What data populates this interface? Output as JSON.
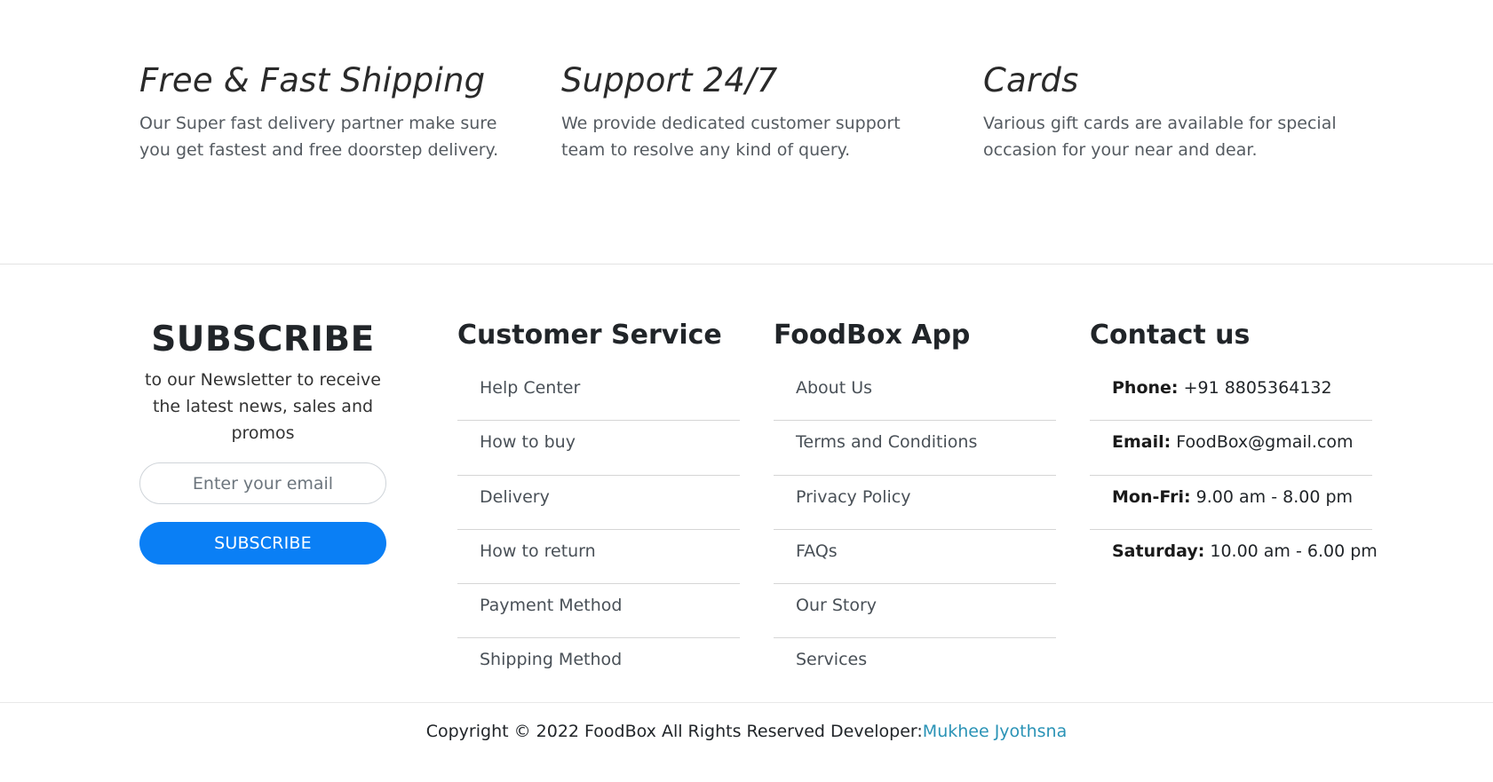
{
  "features": [
    {
      "title": "Free & Fast Shipping",
      "text": "Our Super fast delivery partner make sure you get fastest and free doorstep delivery."
    },
    {
      "title": "Support 24/7",
      "text": "We provide dedicated customer support team to resolve any kind of query."
    },
    {
      "title": "Cards",
      "text": "Various gift cards are available for special occasion for your near and dear."
    }
  ],
  "subscribe": {
    "title": "SUBSCRIBE",
    "text": "to our Newsletter to receive the latest news, sales and promos",
    "email_placeholder": "Enter your email",
    "button_label": "SUBSCRIBE",
    "button_color": "#0a7ff5"
  },
  "customer_service": {
    "title": "Customer Service",
    "items": [
      "Help Center",
      "How to buy",
      "Delivery",
      "How to return",
      "Payment Method",
      "Shipping Method"
    ]
  },
  "foodbox_app": {
    "title": "FoodBox App",
    "items": [
      "About Us",
      "Terms and Conditions",
      "Privacy Policy",
      "FAQs",
      "Our Story",
      "Services"
    ]
  },
  "contact": {
    "title": "Contact us",
    "items": [
      {
        "label": "Phone:",
        "value": "+91 8805364132"
      },
      {
        "label": "Email:",
        "value": "FoodBox@gmail.com"
      },
      {
        "label": "Mon-Fri:",
        "value": "9.00 am - 8.00 pm"
      },
      {
        "label": "Saturday:",
        "value": "10.00 am - 6.00 pm"
      }
    ]
  },
  "copyright": {
    "text": "Copyright © 2022 FoodBox All Rights Reserved Developer:",
    "developer": "Mukhee Jyothsna",
    "link_color": "#2a93b6"
  }
}
